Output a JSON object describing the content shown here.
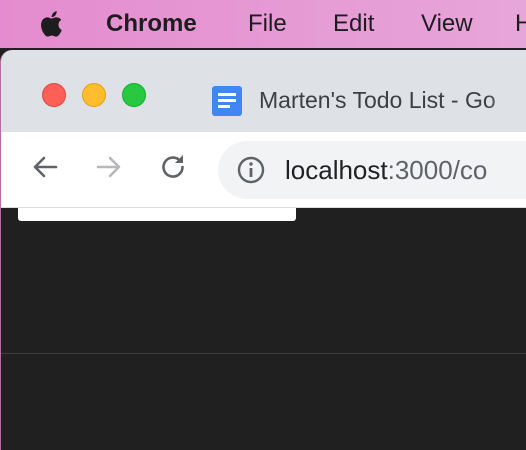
{
  "menubar": {
    "apple_icon": "apple-icon",
    "app_name": "Chrome",
    "items": [
      "File",
      "Edit",
      "View",
      "H"
    ]
  },
  "window_controls": {
    "close_color": "#fe5f57",
    "minimize_color": "#febc2e",
    "zoom_color": "#28c840"
  },
  "tab": {
    "favicon": "google-docs-icon",
    "title": "Marten's Todo List - Go"
  },
  "toolbar": {
    "back_icon": "back-arrow-icon",
    "forward_icon": "forward-arrow-icon",
    "reload_icon": "reload-icon",
    "info_icon": "info-icon",
    "url_host": "localhost",
    "url_rest": ":3000/co"
  }
}
